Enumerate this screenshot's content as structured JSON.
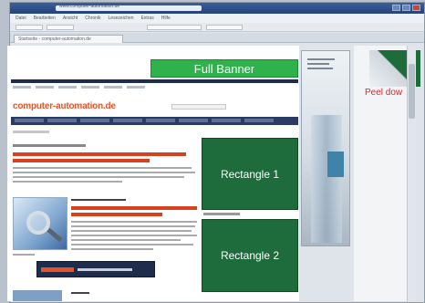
{
  "browser": {
    "address": "www.computer-automation.de",
    "tab_title": "Startseite - computer-automation.de",
    "menu_items": [
      "Datei",
      "Bearbeiten",
      "Ansicht",
      "Chronik",
      "Lesezeichen",
      "Extras",
      "Hilfe"
    ]
  },
  "site": {
    "logo": "computer-automation.de"
  },
  "ads": {
    "full_banner": "Full Banner",
    "rectangle_1": "Rectangle 1",
    "rectangle_2": "Rectangle 2",
    "peel_down": "Peel dow"
  }
}
